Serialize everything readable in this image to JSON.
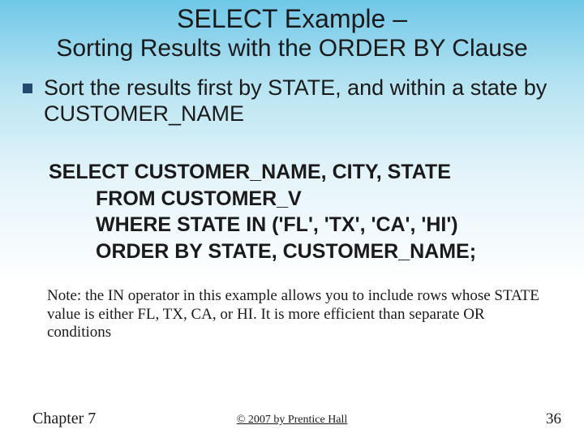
{
  "title": {
    "line1": "SELECT Example –",
    "line2": "Sorting Results with the ORDER BY Clause"
  },
  "bullet": {
    "text": "Sort the results first by STATE, and within a state by CUSTOMER_NAME"
  },
  "sql": {
    "line1": "SELECT CUSTOMER_NAME, CITY, STATE",
    "line2": "FROM CUSTOMER_V",
    "line3_pre": "WHERE STATE ",
    "line3_kw": "IN",
    "line3_post": " ('FL', 'TX', 'CA', 'HI')",
    "line4_kw": "ORDER BY",
    "line4_post": " STATE, CUSTOMER_NAME;"
  },
  "note": "Note: the IN operator in this example allows you to include rows whose STATE value is either FL, TX, CA, or HI. It is more efficient than separate OR conditions",
  "footer": {
    "left": "Chapter 7",
    "center": "© 2007 by Prentice Hall",
    "right": "36"
  }
}
